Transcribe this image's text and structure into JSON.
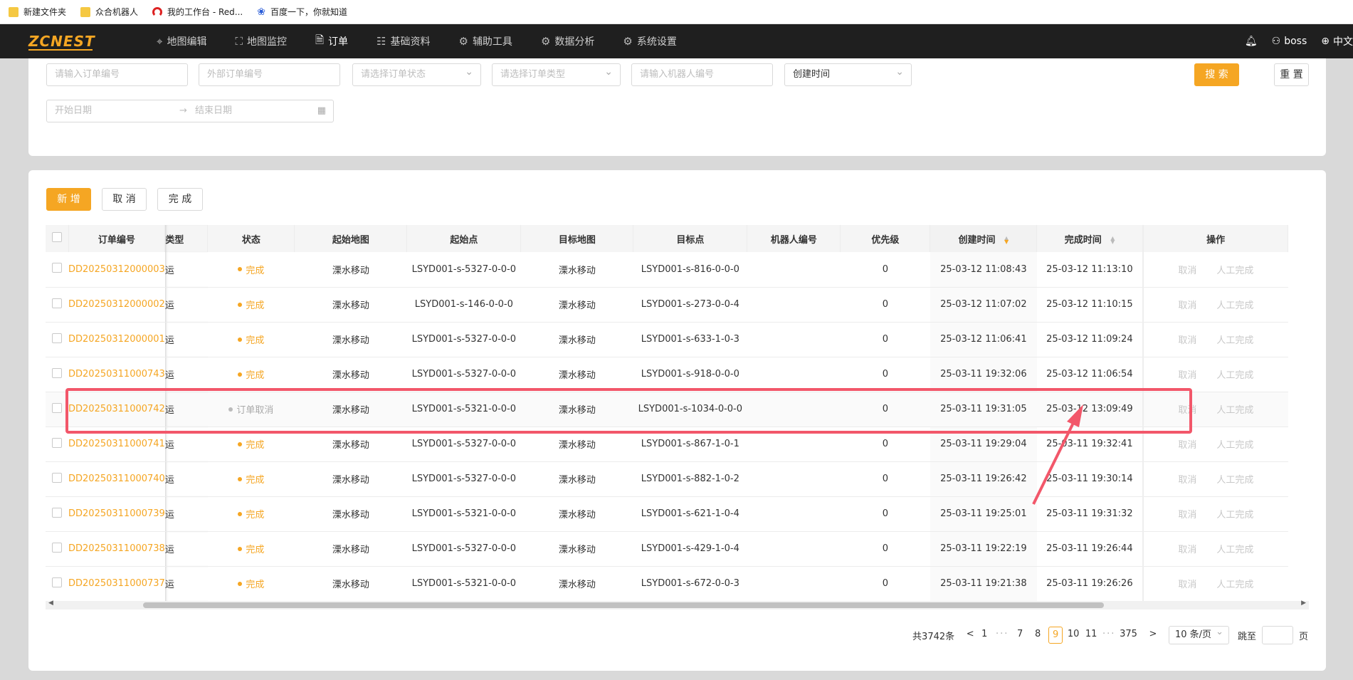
{
  "bookmarks": [
    {
      "label": "新建文件夹",
      "icon": "folder-icon"
    },
    {
      "label": "众合机器人",
      "icon": "folder-icon"
    },
    {
      "label": "我的工作台 - Red...",
      "icon": "redhat-icon"
    },
    {
      "label": "百度一下，你就知道",
      "icon": "baidu-paw-icon"
    }
  ],
  "nav": {
    "logo": "ZCNEST",
    "items": [
      {
        "label": "地图编辑",
        "icon": "map-pin-icon",
        "glyph": "⌖"
      },
      {
        "label": "地图监控",
        "icon": "chart-line-icon",
        "glyph": "⛶"
      },
      {
        "label": "订单",
        "icon": "document-icon",
        "glyph": "🗎",
        "active": true
      },
      {
        "label": "基础资料",
        "icon": "sliders-icon",
        "glyph": "☷"
      },
      {
        "label": "辅助工具",
        "icon": "gear-icon",
        "glyph": "⚙"
      },
      {
        "label": "数据分析",
        "icon": "gear-icon",
        "glyph": "⚙"
      },
      {
        "label": "系统设置",
        "icon": "gear-icon",
        "glyph": "⚙"
      }
    ],
    "user": "boss",
    "language": "中文"
  },
  "filters": {
    "order_no_placeholder": "请输入订单编号",
    "external_no_placeholder": "外部订单编号",
    "status_placeholder": "请选择订单状态",
    "type_placeholder": "请选择订单类型",
    "robot_placeholder": "请输入机器人编号",
    "time_type_value": "创建时间",
    "start_date_placeholder": "开始日期",
    "end_date_placeholder": "结束日期",
    "range_arrow": "→",
    "search_label": "搜 索",
    "reset_label": "重 置"
  },
  "toolbar": {
    "add_label": "新 增",
    "cancel_label": "取 消",
    "complete_label": "完 成"
  },
  "table": {
    "headers": [
      "订单编号",
      "类型",
      "状态",
      "起始地图",
      "起始点",
      "目标地图",
      "目标点",
      "机器人编号",
      "优先级",
      "创建时间",
      "完成时间",
      "操作"
    ],
    "op_cancel": "取消",
    "op_manual_complete": "人工完成",
    "rows": [
      {
        "order_no": "DD20250312000003",
        "type": "运",
        "status": "完成",
        "status_kind": "done",
        "start_map": "溧水移动",
        "start_point": "LSYD001-s-5327-0-0-0",
        "target_map": "溧水移动",
        "target_point": "LSYD001-s-816-0-0-0",
        "robot": "",
        "priority": "0",
        "created": "25-03-12 11:08:43",
        "finished": "25-03-12 11:13:10"
      },
      {
        "order_no": "DD20250312000002",
        "type": "运",
        "status": "完成",
        "status_kind": "done",
        "start_map": "溧水移动",
        "start_point": "LSYD001-s-146-0-0-0",
        "target_map": "溧水移动",
        "target_point": "LSYD001-s-273-0-0-4",
        "robot": "",
        "priority": "0",
        "created": "25-03-12 11:07:02",
        "finished": "25-03-12 11:10:15"
      },
      {
        "order_no": "DD20250312000001",
        "type": "运",
        "status": "完成",
        "status_kind": "done",
        "start_map": "溧水移动",
        "start_point": "LSYD001-s-5327-0-0-0",
        "target_map": "溧水移动",
        "target_point": "LSYD001-s-633-1-0-3",
        "robot": "",
        "priority": "0",
        "created": "25-03-12 11:06:41",
        "finished": "25-03-12 11:09:24"
      },
      {
        "order_no": "DD20250311000743",
        "type": "运",
        "status": "完成",
        "status_kind": "done",
        "start_map": "溧水移动",
        "start_point": "LSYD001-s-5327-0-0-0",
        "target_map": "溧水移动",
        "target_point": "LSYD001-s-918-0-0-0",
        "robot": "",
        "priority": "0",
        "created": "25-03-11 19:32:06",
        "finished": "25-03-12 11:06:54"
      },
      {
        "order_no": "DD20250311000742",
        "type": "运",
        "status": "订单取消",
        "status_kind": "cancelled",
        "start_map": "溧水移动",
        "start_point": "LSYD001-s-5321-0-0-0",
        "target_map": "溧水移动",
        "target_point": "LSYD001-s-1034-0-0-0",
        "robot": "",
        "priority": "0",
        "created": "25-03-11 19:31:05",
        "finished": "25-03-12 13:09:49"
      },
      {
        "order_no": "DD20250311000741",
        "type": "运",
        "status": "完成",
        "status_kind": "done",
        "start_map": "溧水移动",
        "start_point": "LSYD001-s-5327-0-0-0",
        "target_map": "溧水移动",
        "target_point": "LSYD001-s-867-1-0-1",
        "robot": "",
        "priority": "0",
        "created": "25-03-11 19:29:04",
        "finished": "25-03-11 19:32:41"
      },
      {
        "order_no": "DD20250311000740",
        "type": "运",
        "status": "完成",
        "status_kind": "done",
        "start_map": "溧水移动",
        "start_point": "LSYD001-s-5327-0-0-0",
        "target_map": "溧水移动",
        "target_point": "LSYD001-s-882-1-0-2",
        "robot": "",
        "priority": "0",
        "created": "25-03-11 19:26:42",
        "finished": "25-03-11 19:30:14"
      },
      {
        "order_no": "DD20250311000739",
        "type": "运",
        "status": "完成",
        "status_kind": "done",
        "start_map": "溧水移动",
        "start_point": "LSYD001-s-5321-0-0-0",
        "target_map": "溧水移动",
        "target_point": "LSYD001-s-621-1-0-4",
        "robot": "",
        "priority": "0",
        "created": "25-03-11 19:25:01",
        "finished": "25-03-11 19:31:32"
      },
      {
        "order_no": "DD20250311000738",
        "type": "运",
        "status": "完成",
        "status_kind": "done",
        "start_map": "溧水移动",
        "start_point": "LSYD001-s-5327-0-0-0",
        "target_map": "溧水移动",
        "target_point": "LSYD001-s-429-1-0-4",
        "robot": "",
        "priority": "0",
        "created": "25-03-11 19:22:19",
        "finished": "25-03-11 19:26:44"
      },
      {
        "order_no": "DD20250311000737",
        "type": "运",
        "status": "完成",
        "status_kind": "done",
        "start_map": "溧水移动",
        "start_point": "LSYD001-s-5321-0-0-0",
        "target_map": "溧水移动",
        "target_point": "LSYD001-s-672-0-0-3",
        "robot": "",
        "priority": "0",
        "created": "25-03-11 19:21:38",
        "finished": "25-03-11 19:26:26"
      }
    ]
  },
  "pagination": {
    "total": "共3742条",
    "prev": "<",
    "next": ">",
    "pages": [
      "1",
      "···",
      "7",
      "8",
      "9",
      "10",
      "11",
      "···",
      "375"
    ],
    "current": "9",
    "page_size": "10 条/页",
    "jump_label": "跳至",
    "page_suffix": "页"
  },
  "colors": {
    "accent": "#f5a623",
    "nav_bg": "#1f1f1f",
    "highlight": "#f2576a"
  }
}
